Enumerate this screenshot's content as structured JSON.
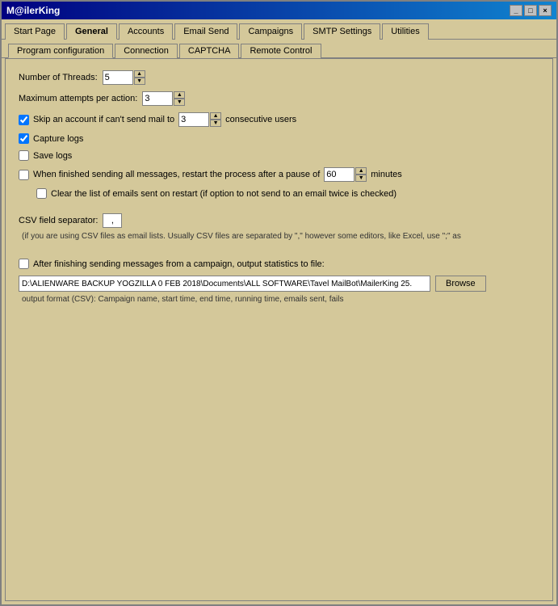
{
  "window": {
    "title": "M@ilerKing",
    "title_label": "M@ilerKing"
  },
  "title_buttons": {
    "minimize": "_",
    "maximize": "□",
    "close": "×"
  },
  "main_tabs": [
    {
      "id": "start-page",
      "label": "Start Page",
      "active": false
    },
    {
      "id": "general",
      "label": "General",
      "active": true
    },
    {
      "id": "accounts",
      "label": "Accounts",
      "active": false
    },
    {
      "id": "email-send",
      "label": "Email Send",
      "active": false
    },
    {
      "id": "campaigns",
      "label": "Campaigns",
      "active": false
    },
    {
      "id": "smtp-settings",
      "label": "SMTP Settings",
      "active": false
    },
    {
      "id": "utilities",
      "label": "Utilities",
      "active": false
    }
  ],
  "sub_tabs": [
    {
      "id": "program-config",
      "label": "Program configuration",
      "active": true
    },
    {
      "id": "connection",
      "label": "Connection",
      "active": false
    },
    {
      "id": "captcha",
      "label": "CAPTCHA",
      "active": false
    },
    {
      "id": "remote-control",
      "label": "Remote Control",
      "active": false
    }
  ],
  "form": {
    "threads_label": "Number of Threads:",
    "threads_value": "5",
    "attempts_label": "Maximum attempts per action:",
    "attempts_value": "3",
    "skip_account_label": "Skip an account if can't send mail to",
    "skip_account_value": "3",
    "skip_account_suffix": "consecutive users",
    "skip_account_checked": true,
    "capture_logs_label": "Capture logs",
    "capture_logs_checked": true,
    "save_logs_label": "Save logs",
    "save_logs_checked": false,
    "restart_label": "When finished sending all messages, restart the process after a pause of",
    "restart_value": "60",
    "restart_suffix": "minutes",
    "restart_checked": false,
    "clear_list_label": "Clear the list of emails sent on restart (if option to not send to an email twice is checked)",
    "clear_list_checked": false,
    "csv_separator_label": "CSV field separator:",
    "csv_separator_value": ",",
    "csv_hint": "(if you are using CSV files as email lists. Usually CSV files are separated by \",\" however some editors, like Excel, use \";\" as",
    "stats_label": "After finishing sending messages from a campaign, output statistics to file:",
    "stats_checked": false,
    "stats_file_value": "D:\\ALIENWARE BACKUP YOGZILLA 0 FEB 2018\\Documents\\ALL SOFTWARE\\Tavel MailBot\\MailerKing 25.",
    "browse_label": "Browse",
    "output_hint": "output format (CSV): Campaign name, start time, end time, running time, emails sent, fails"
  }
}
